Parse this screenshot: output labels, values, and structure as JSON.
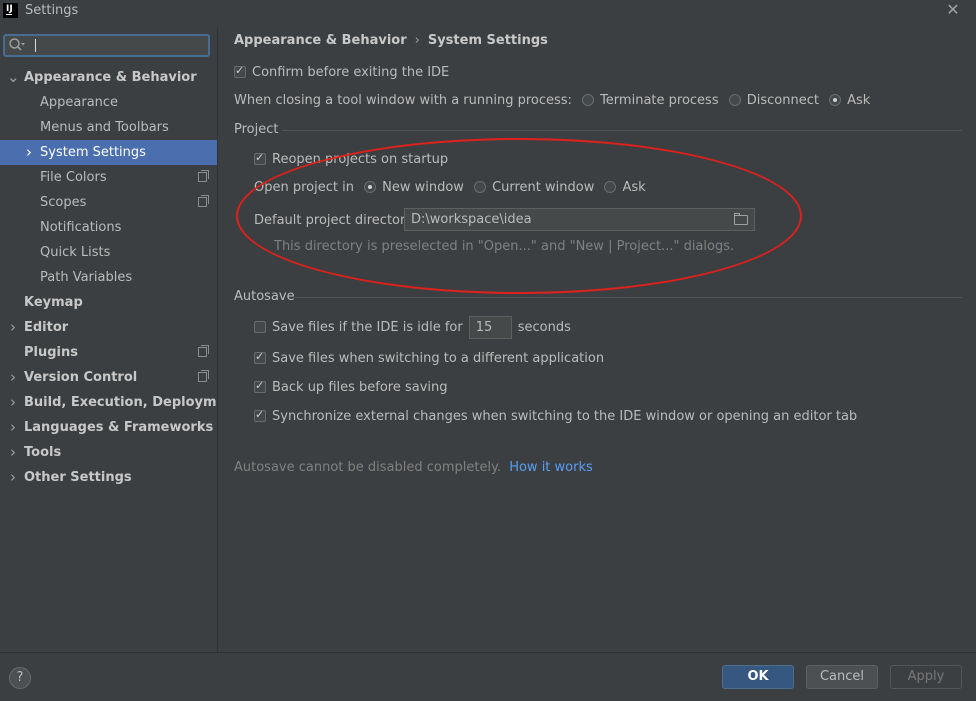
{
  "window": {
    "title": "Settings",
    "app_icon_text": "IJ",
    "close_glyph": "✕"
  },
  "search": {
    "value": "",
    "placeholder": "",
    "icon": "search-icon"
  },
  "tree": {
    "items": [
      {
        "label": "Appearance & Behavior",
        "expanded": true,
        "bold": true
      },
      {
        "label": "Appearance"
      },
      {
        "label": "Menus and Toolbars"
      },
      {
        "label": "System Settings",
        "selected": true,
        "collapsed": true
      },
      {
        "label": "File Colors",
        "project_icon": true
      },
      {
        "label": "Scopes",
        "project_icon": true
      },
      {
        "label": "Notifications"
      },
      {
        "label": "Quick Lists"
      },
      {
        "label": "Path Variables"
      },
      {
        "label": "Keymap",
        "bold": true
      },
      {
        "label": "Editor",
        "bold": true,
        "collapsed": true
      },
      {
        "label": "Plugins",
        "bold": true,
        "project_icon": true
      },
      {
        "label": "Version Control",
        "bold": true,
        "collapsed": true,
        "project_icon": true
      },
      {
        "label": "Build, Execution, Deployment",
        "bold": true,
        "collapsed": true
      },
      {
        "label": "Languages & Frameworks",
        "bold": true,
        "collapsed": true
      },
      {
        "label": "Tools",
        "bold": true,
        "collapsed": true
      },
      {
        "label": "Other Settings",
        "bold": true,
        "collapsed": true
      }
    ]
  },
  "breadcrumb": {
    "parent": "Appearance & Behavior",
    "sep": "›",
    "current": "System Settings"
  },
  "general": {
    "confirm_exit": {
      "label": "Confirm before exiting the IDE",
      "checked": true
    },
    "closing_label": "When closing a tool window with a running process:",
    "closing_options": [
      {
        "label": "Terminate process",
        "selected": false
      },
      {
        "label": "Disconnect",
        "selected": false
      },
      {
        "label": "Ask",
        "selected": true
      }
    ]
  },
  "project": {
    "section": "Project",
    "reopen": {
      "label": "Reopen projects on startup",
      "checked": true
    },
    "open_in_label": "Open project in",
    "open_options": [
      {
        "label": "New window",
        "selected": true
      },
      {
        "label": "Current window",
        "selected": false
      },
      {
        "label": "Ask",
        "selected": false
      }
    ],
    "dir_label": "Default project directory:",
    "dir_value": "D:\\workspace\\idea",
    "hint": "This directory is preselected in \"Open...\" and \"New | Project...\" dialogs."
  },
  "autosave": {
    "section": "Autosave",
    "idle": {
      "label": "Save files if the IDE is idle for",
      "checked": false,
      "value": "15",
      "unit": "seconds"
    },
    "switch_app": {
      "label": "Save files when switching to a different application",
      "checked": true
    },
    "backup": {
      "label": "Back up files before saving",
      "checked": true
    },
    "sync": {
      "label": "Synchronize external changes when switching to the IDE window or opening an editor tab",
      "checked": true
    },
    "note": "Autosave cannot be disabled completely.",
    "link": "How it works"
  },
  "footer": {
    "help": "?",
    "ok": "OK",
    "cancel": "Cancel",
    "apply": "Apply"
  },
  "colors": {
    "selection": "#4b6eaf",
    "primary_button": "#365880",
    "link": "#589df6",
    "annotation": "#e0201b"
  }
}
